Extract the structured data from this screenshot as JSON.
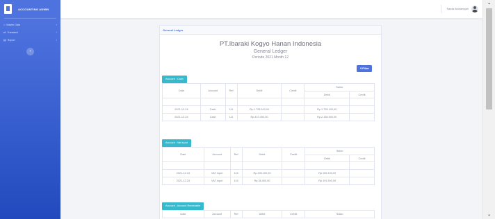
{
  "sidebar": {
    "brand": "ACCOUNTING ADMIN",
    "items": [
      {
        "icon": "home-icon",
        "glyph": "⌂",
        "label": "Master Data"
      },
      {
        "icon": "transfer-icon",
        "glyph": "⇄",
        "label": "Transaksi"
      },
      {
        "icon": "report-icon",
        "glyph": "▤",
        "label": "Report"
      }
    ],
    "toggle_glyph": "‹"
  },
  "topbar": {
    "user_name": "Nanda Andriansyah"
  },
  "card": {
    "header": "General Ledger",
    "company": "PT.Ibaraki Kogyo Hanan Indonesia",
    "title": "General Ledger",
    "period": "Periode 2021 Month 12",
    "filter_label": "Filter"
  },
  "columns": {
    "date": "Date",
    "account": "Account",
    "ref": "Ref",
    "debit": "Debit",
    "credit": "Credit",
    "saldo": "Saldo",
    "saldo_debit": "Debit",
    "saldo_credit": "Credit"
  },
  "ledgers": [
    {
      "account_label": "Account : Cash",
      "rows": [
        {
          "date": "2021-12-24",
          "account": "Cash",
          "ref": "111",
          "debit": "Rp.1.728.100,00",
          "credit": "",
          "saldo_debit": "Rp.1.728.100,00",
          "saldo_credit": ""
        },
        {
          "date": "2021-12-24",
          "account": "Cash",
          "ref": "111",
          "debit": "Rp.410.400,00",
          "credit": "",
          "saldo_debit": "Rp.2.138.500,00",
          "saldo_credit": ""
        }
      ]
    },
    {
      "account_label": "Account : Vat Input",
      "rows": [
        {
          "date": "2021-12-24",
          "account": "VAT Input",
          "ref": "115",
          "debit": "Rp.155.100,00",
          "credit": "",
          "saldo_debit": "Rp.155.100,00",
          "saldo_credit": ""
        },
        {
          "date": "2021-12-24",
          "account": "VAT Input",
          "ref": "115",
          "debit": "Rp.36.400,00",
          "credit": "",
          "saldo_debit": "Rp.191.500,00",
          "saldo_credit": ""
        }
      ]
    },
    {
      "account_label": "Account : Account Receivable",
      "rows": []
    }
  ],
  "colors": {
    "primary": "#4e73df",
    "info": "#36b9cc"
  }
}
